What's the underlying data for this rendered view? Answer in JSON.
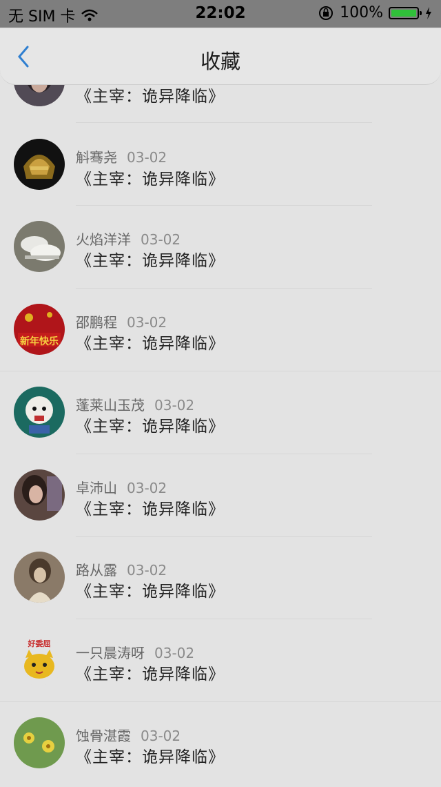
{
  "status": {
    "carrier": "无 SIM 卡",
    "time": "22:02",
    "battery": "100%",
    "battery_level": 1.0
  },
  "nav": {
    "title": "收藏"
  },
  "colors": {
    "overlay": "#7e7e7e",
    "back": "#2f7fd0",
    "battery_fill": "#30c03a"
  },
  "items": [
    {
      "name": "",
      "date": "",
      "content": "《主宰：诡异降临》",
      "avatar": "avatar-dark-hair"
    },
    {
      "name": "斛骞尧",
      "date": "03-02",
      "content": "《主宰：诡异降临》",
      "avatar": "avatar-golden-helmet"
    },
    {
      "name": "火焰洋洋",
      "date": "03-02",
      "content": "《主宰：诡异降临》",
      "avatar": "avatar-sneakers"
    },
    {
      "name": "邵鹏程",
      "date": "03-02",
      "content": "《主宰：诡异降临》",
      "avatar": "avatar-red-new-year",
      "avatar_text": "新年快乐"
    },
    {
      "name": "蓬莱山玉茂",
      "date": "03-02",
      "content": "《主宰：诡异降临》",
      "avatar": "avatar-cartoon-character"
    },
    {
      "name": "卓沛山",
      "date": "03-02",
      "content": "《主宰：诡异降临》",
      "avatar": "avatar-girl-photo"
    },
    {
      "name": "路从露",
      "date": "03-02",
      "content": "《主宰：诡异降临》",
      "avatar": "avatar-sepia-photo"
    },
    {
      "name": "一只晨涛呀",
      "date": "03-02",
      "content": "《主宰：诡异降临》",
      "avatar": "avatar-yellow-cat",
      "avatar_text": "好委屈"
    },
    {
      "name": "蚀骨湛霞",
      "date": "03-02",
      "content": "《主宰：诡异降临》",
      "avatar": "avatar-flowers"
    }
  ]
}
